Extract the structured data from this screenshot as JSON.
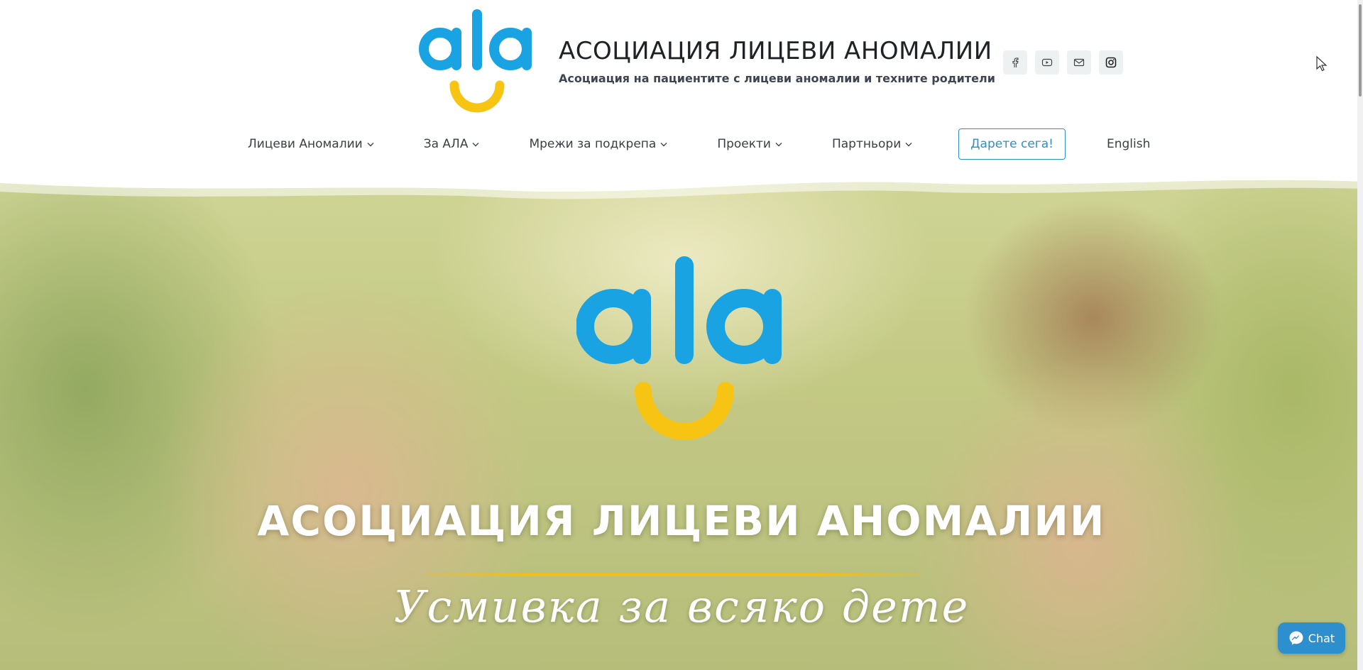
{
  "header": {
    "logo_text": "ala",
    "title": "АСОЦИАЦИЯ ЛИЦЕВИ АНОМАЛИИ",
    "subtitle": "Асоциация на пациентите с лицеви аномалии и техните родители",
    "social": [
      "facebook-icon",
      "youtube-icon",
      "mail-icon",
      "instagram-icon"
    ]
  },
  "nav": {
    "items": [
      {
        "label": "Лицеви Аномалии"
      },
      {
        "label": "За АЛА"
      },
      {
        "label": "Мрежи за подкрепа"
      },
      {
        "label": "Проекти"
      },
      {
        "label": "Партньори"
      }
    ],
    "donate_label": "Дарете сега!",
    "language_label": "English"
  },
  "hero": {
    "logo_text": "ala",
    "title": "АСОЦИАЦИЯ ЛИЦЕВИ АНОМАЛИИ",
    "tagline": "Усмивка за всяко дете"
  },
  "chat": {
    "label": "Chat"
  },
  "colors": {
    "brand_blue": "#1aa3e3",
    "brand_yellow": "#f8c414",
    "donate_border": "#2f8fc4",
    "chat_bg": "#2e8fcf"
  }
}
